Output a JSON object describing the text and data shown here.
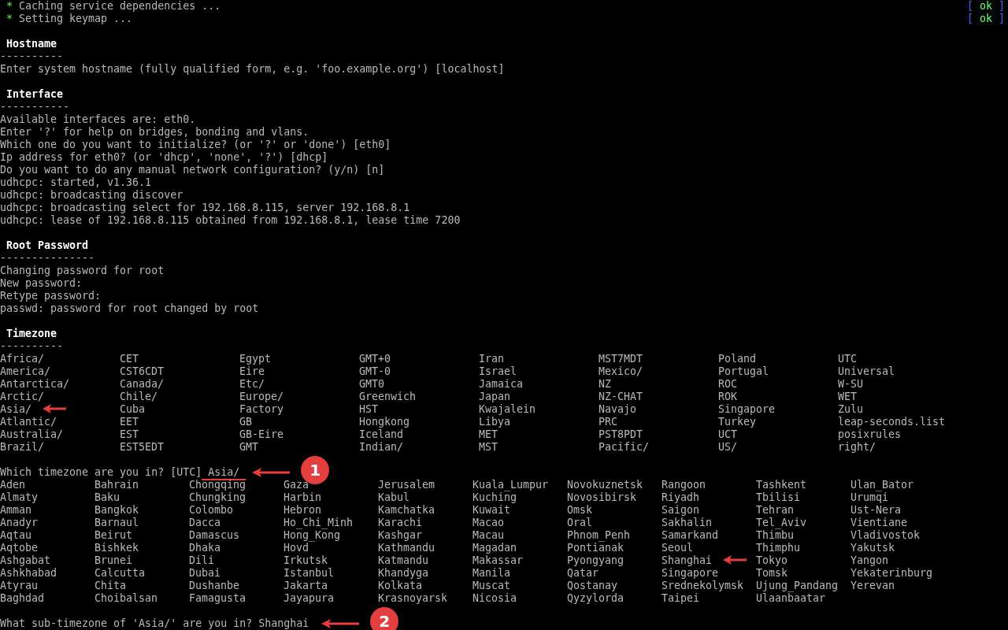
{
  "status_lines": [
    {
      "bullet": "*",
      "text": "Caching service dependencies ...",
      "brackets": [
        "[",
        "]"
      ],
      "result": "ok"
    },
    {
      "bullet": "*",
      "text": "Setting keymap ...",
      "brackets": [
        "[",
        "]"
      ],
      "result": "ok"
    }
  ],
  "sections": [
    {
      "title": "Hostname",
      "rule": "----------",
      "items": [
        {
          "kind": "line",
          "text": "Enter system hostname (fully qualified form, e.g. 'foo.example.org') [localhost]"
        }
      ]
    },
    {
      "title": "Interface",
      "rule": "-----------",
      "items": [
        {
          "kind": "line",
          "text": "Available interfaces are: eth0."
        },
        {
          "kind": "line",
          "text": "Enter '?' for help on bridges, bonding and vlans."
        },
        {
          "kind": "line",
          "text": "Which one do you want to initialize? (or '?' or 'done') [eth0]"
        },
        {
          "kind": "line",
          "text": "Ip address for eth0? (or 'dhcp', 'none', '?') [dhcp]"
        },
        {
          "kind": "line",
          "text": "Do you want to do any manual network configuration? (y/n) [n]"
        },
        {
          "kind": "line",
          "text": "udhcpc: started, v1.36.1"
        },
        {
          "kind": "line",
          "text": "udhcpc: broadcasting discover"
        },
        {
          "kind": "line",
          "text": "udhcpc: broadcasting select for 192.168.8.115, server 192.168.8.1"
        },
        {
          "kind": "line",
          "text": "udhcpc: lease of 192.168.8.115 obtained from 192.168.8.1, lease time 7200"
        }
      ]
    },
    {
      "title": "Root Password",
      "rule": "---------------",
      "items": [
        {
          "kind": "line",
          "text": "Changing password for root"
        },
        {
          "kind": "line",
          "text": "New password:"
        },
        {
          "kind": "line",
          "text": "Retype password:"
        },
        {
          "kind": "line",
          "text": "passwd: password for root changed by root"
        }
      ]
    },
    {
      "title": "Timezone",
      "rule": "----------",
      "items": [
        {
          "kind": "grid",
          "rows": [
            [
              "Africa/",
              "CET",
              "Egypt",
              "GMT+0",
              "Iran",
              "MST7MDT",
              "Poland",
              "UTC"
            ],
            [
              "America/",
              "CST6CDT",
              "Eire",
              "GMT-0",
              "Israel",
              "Mexico/",
              "Portugal",
              "Universal"
            ],
            [
              "Antarctica/",
              "Canada/",
              "Etc/",
              "GMT0",
              "Jamaica",
              "NZ",
              "ROC",
              "W-SU"
            ],
            [
              "Arctic/",
              "Chile/",
              "Europe/",
              "Greenwich",
              "Japan",
              "NZ-CHAT",
              "ROK",
              "WET"
            ],
            [
              {
                "text": "Asia/",
                "arrow": true
              },
              "Cuba",
              "Factory",
              "HST",
              "Kwajalein",
              "Navajo",
              "Singapore",
              "Zulu"
            ],
            [
              "Atlantic/",
              "EET",
              "GB",
              "Hongkong",
              "Libya",
              "PRC",
              "Turkey",
              "leap-seconds.list"
            ],
            [
              "Australia/",
              "EST",
              "GB-Eire",
              "Iceland",
              "MET",
              "PST8PDT",
              "UCT",
              "posixrules"
            ],
            [
              "Brazil/",
              "EST5EDT",
              "GMT",
              "Indian/",
              "MST",
              "Pacific/",
              "US/",
              "right/"
            ]
          ]
        },
        {
          "kind": "prompt",
          "text": "Which timezone are you in? [UTC]",
          "answer": "Asia/",
          "underline": true,
          "callout": "1"
        },
        {
          "kind": "grid",
          "rows": [
            [
              "Aden",
              "Bahrain",
              "Chongqing",
              "Gaza",
              "Jerusalem",
              "Kuala_Lumpur",
              "Novokuznetsk",
              "Rangoon",
              "Tashkent",
              "Ulan_Bator"
            ],
            [
              "Almaty",
              "Baku",
              "Chungking",
              "Harbin",
              "Kabul",
              "Kuching",
              "Novosibirsk",
              "Riyadh",
              "Tbilisi",
              "Urumqi"
            ],
            [
              "Amman",
              "Bangkok",
              "Colombo",
              "Hebron",
              "Kamchatka",
              "Kuwait",
              "Omsk",
              "Saigon",
              "Tehran",
              "Ust-Nera"
            ],
            [
              "Anadyr",
              "Barnaul",
              "Dacca",
              "Ho_Chi_Minh",
              "Karachi",
              "Macao",
              "Oral",
              "Sakhalin",
              "Tel_Aviv",
              "Vientiane"
            ],
            [
              "Aqtau",
              "Beirut",
              "Damascus",
              "Hong_Kong",
              "Kashgar",
              "Macau",
              "Phnom_Penh",
              "Samarkand",
              "Thimbu",
              "Vladivostok"
            ],
            [
              "Aqtobe",
              "Bishkek",
              "Dhaka",
              "Hovd",
              "Kathmandu",
              "Magadan",
              "Pontianak",
              "Seoul",
              "Thimphu",
              "Yakutsk"
            ],
            [
              "Ashgabat",
              "Brunei",
              "Dili",
              "Irkutsk",
              "Katmandu",
              "Makassar",
              "Pyongyang",
              {
                "text": "Shanghai",
                "arrow": true
              },
              "Tokyo",
              "Yangon"
            ],
            [
              "Ashkhabad",
              "Calcutta",
              "Dubai",
              "Istanbul",
              "Khandyga",
              "Manila",
              "Qatar",
              "Singapore",
              "Tomsk",
              "Yekaterinburg"
            ],
            [
              "Atyrau",
              "Chita",
              "Dushanbe",
              "Jakarta",
              "Kolkata",
              "Muscat",
              "Qostanay",
              "Srednekolymsk",
              "Ujung_Pandang",
              "Yerevan"
            ],
            [
              "Baghdad",
              "Choibalsan",
              "Famagusta",
              "Jayapura",
              "Krasnoyarsk",
              "Nicosia",
              "Qyzylorda",
              "Taipei",
              "Ulaanbaatar"
            ]
          ]
        },
        {
          "kind": "prompt",
          "text": "What sub-timezone of 'Asia/' are you in?",
          "answer": "Shanghai",
          "callout": "2"
        }
      ]
    }
  ]
}
